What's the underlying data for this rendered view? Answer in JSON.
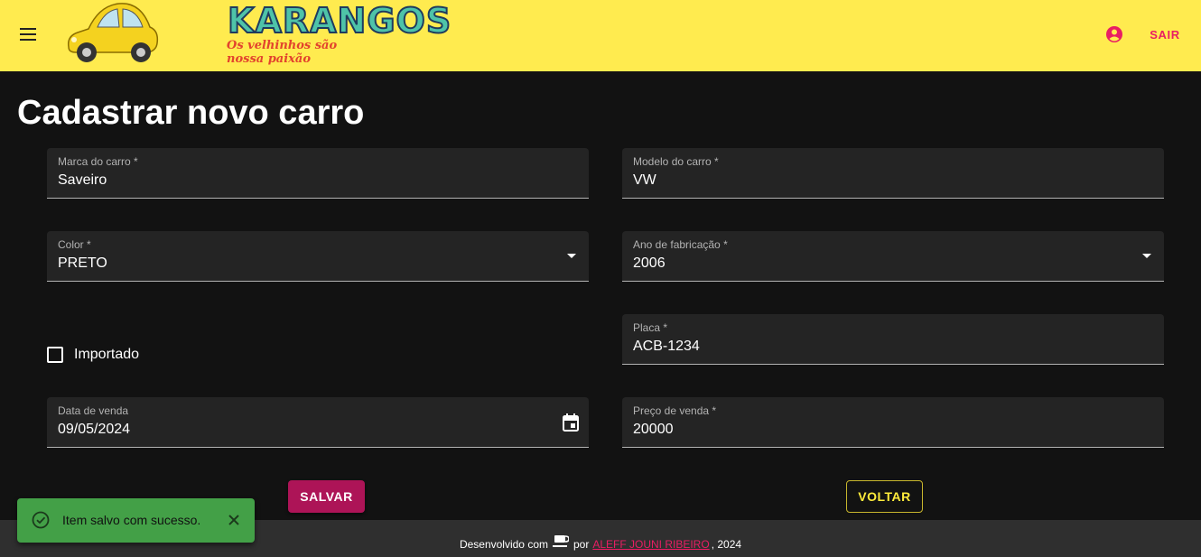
{
  "header": {
    "logo_title": "KARANGOS",
    "logo_slogan": "Os velhinhos são nossa paixão",
    "logout_label": "SAIR",
    "icons": {
      "menu": "menu-icon",
      "account": "account-circle-icon"
    },
    "colors": {
      "appbar": "#ffeb4f",
      "accent": "#e91e63"
    }
  },
  "page": {
    "title": "Cadastrar novo carro"
  },
  "form": {
    "brand": {
      "label": "Marca do carro *",
      "value": "Saveiro"
    },
    "model": {
      "label": "Modelo do carro *",
      "value": "VW"
    },
    "color": {
      "label": "Color *",
      "value": "PRETO"
    },
    "year": {
      "label": "Ano de fabricação *",
      "value": "2006"
    },
    "imported": {
      "label": "Importado",
      "checked": false
    },
    "plate": {
      "label": "Placa *",
      "value": "ACB-1234"
    },
    "sale_date": {
      "label": "Data de venda",
      "value": "09/05/2024"
    },
    "sale_price": {
      "label": "Preço de venda *",
      "value": "20000"
    },
    "save_label": "SALVAR",
    "back_label": "VOLTAR"
  },
  "footer": {
    "prefix": "Desenvolvido com",
    "by": "por",
    "author": "ALEFF JOUNI RIBEIRO",
    "suffix": ", 2024",
    "icon": "coffee-icon"
  },
  "snackbar": {
    "message": "Item salvo com sucesso.",
    "color": "#43a047"
  }
}
